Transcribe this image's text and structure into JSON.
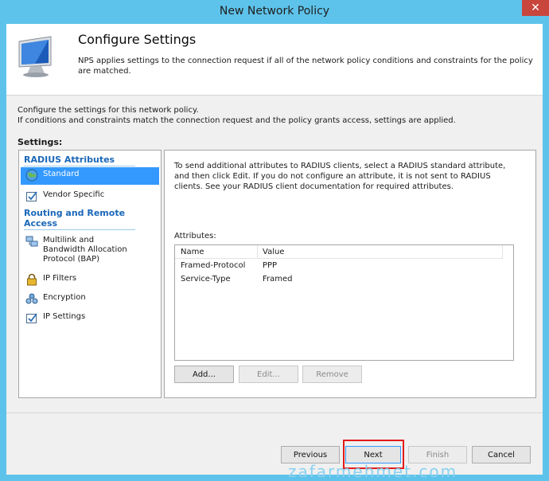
{
  "window": {
    "title": "New Network Policy",
    "close_glyph": "✕"
  },
  "header": {
    "title": "Configure Settings",
    "description": "NPS applies settings to the connection request if all of the network policy conditions and constraints for the policy are matched.",
    "icon": "computer-monitor-icon"
  },
  "intro": {
    "line1": "Configure the settings for this network policy.",
    "line2": "If conditions and constraints match the connection request and the policy grants access, settings are applied."
  },
  "settings_label": "Settings:",
  "left_panel": {
    "group1_title": "RADIUS Attributes",
    "group2_title": "Routing and Remote Access",
    "items": [
      {
        "label": "Standard",
        "icon": "globe-icon",
        "selected": true
      },
      {
        "label": "Vendor Specific",
        "icon": "checkbox-icon"
      },
      {
        "label": "Multilink and Bandwidth Allocation Protocol (BAP)",
        "icon": "network-link-icon"
      },
      {
        "label": "IP Filters",
        "icon": "lock-icon"
      },
      {
        "label": "Encryption",
        "icon": "encryption-icon"
      },
      {
        "label": "IP Settings",
        "icon": "checkbox-icon"
      }
    ]
  },
  "right_panel": {
    "description": "To send additional attributes to RADIUS clients, select a RADIUS standard attribute, and then click Edit. If you do not configure an attribute, it is not sent to RADIUS clients. See your RADIUS client documentation for required attributes.",
    "attributes_label": "Attributes:",
    "columns": [
      "Name",
      "Value"
    ],
    "rows": [
      {
        "name": "Framed-Protocol",
        "value": "PPP"
      },
      {
        "name": "Service-Type",
        "value": "Framed"
      }
    ],
    "buttons": {
      "add": "Add...",
      "edit": "Edit...",
      "remove": "Remove"
    }
  },
  "footer": {
    "previous": "Previous",
    "next": "Next",
    "finish": "Finish",
    "cancel": "Cancel"
  },
  "colors": {
    "titlebar": "#5ec3ea",
    "selection": "#3399ff",
    "group_title": "#1b67b8",
    "highlight": "#e21a1a"
  },
  "watermark": "zafarmehmet.com"
}
